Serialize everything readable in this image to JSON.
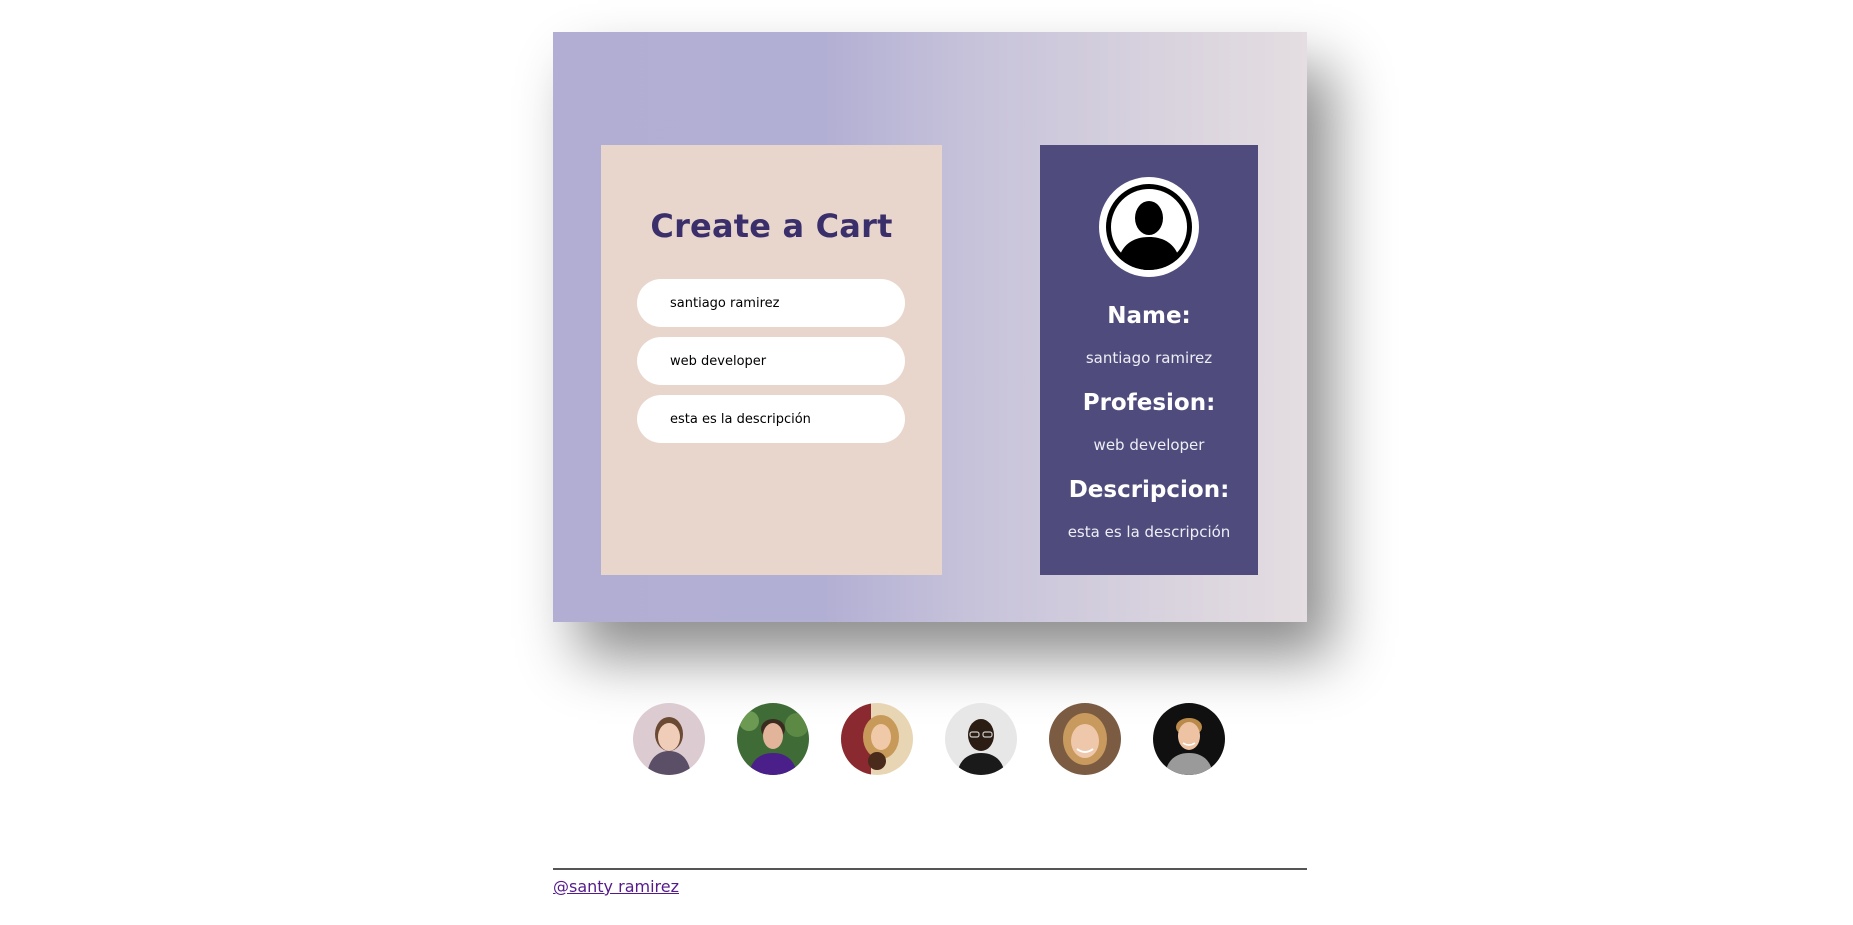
{
  "form": {
    "title": "Create a Cart",
    "fields": {
      "name": "santiago ramirez",
      "profession": "web developer",
      "description": "esta es la descripción"
    }
  },
  "profile": {
    "avatar_icon": "user-silhouette-icon",
    "name_label": "Name:",
    "name_value": "santiago ramirez",
    "profession_label": "Profesion:",
    "profession_value": "web developer",
    "description_label": "Descripcion:",
    "description_value": "esta es la descripción"
  },
  "avatars": [
    {
      "name": "avatar-woman-light-bg",
      "bg": "#d9c9cf"
    },
    {
      "name": "avatar-man-outdoor",
      "bg": "#3e6b35"
    },
    {
      "name": "avatar-woman-blonde",
      "bg": "#e9d3b0"
    },
    {
      "name": "avatar-man-glasses",
      "bg": "#e6e6e6"
    },
    {
      "name": "avatar-woman-smiling",
      "bg": "#7a5a40"
    },
    {
      "name": "avatar-man-dark-bg",
      "bg": "#111111"
    }
  ],
  "footer": {
    "link_text": "@santy ramirez"
  },
  "colors": {
    "title": "#3a2f6b",
    "form_panel": "#e8d6cc",
    "profile_panel": "#4f4b7d",
    "link": "#551a8b"
  }
}
